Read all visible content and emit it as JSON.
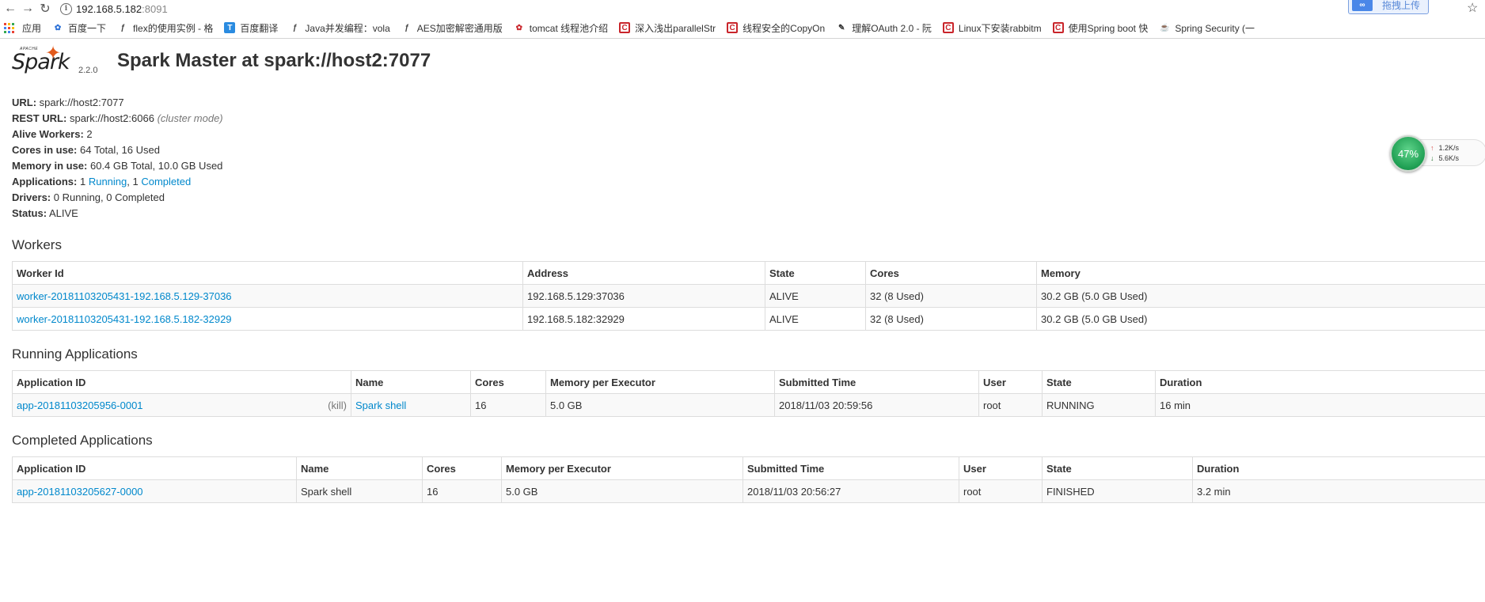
{
  "browser": {
    "url_host": "192.168.5.182",
    "url_port": ":8091",
    "upload_label": "拖拽上传",
    "bookmarks": [
      {
        "label": "应用",
        "icon": "apps-grid-icon"
      },
      {
        "label": "百度一下",
        "icon": "baidu-paw-icon"
      },
      {
        "label": "flex的使用实例 - 格",
        "icon": "leaf-icon"
      },
      {
        "label": "百度翻译",
        "icon": "translate-icon"
      },
      {
        "label": "Java并发编程：vola",
        "icon": "leaf-icon"
      },
      {
        "label": "AES加密解密通用版",
        "icon": "leaf-icon"
      },
      {
        "label": "tomcat 线程池介绍",
        "icon": "chinese-site-icon"
      },
      {
        "label": "深入浅出parallelStr",
        "icon": "csdn-icon"
      },
      {
        "label": "线程安全的CopyOn",
        "icon": "csdn-icon"
      },
      {
        "label": "理解OAuth 2.0 - 阮",
        "icon": "blog-icon"
      },
      {
        "label": "Linux下安装rabbitm",
        "icon": "csdn-icon"
      },
      {
        "label": "使用Spring boot 快",
        "icon": "csdn-icon"
      },
      {
        "label": "Spring Security (一",
        "icon": "java-icon"
      }
    ]
  },
  "header": {
    "logo_apache": "APACHE",
    "logo_word": "Spark",
    "version": "2.2.0",
    "title": "Spark Master at spark://host2:7077"
  },
  "summary": {
    "url_label": "URL:",
    "url_value": "spark://host2:7077",
    "rest_label": "REST URL:",
    "rest_value": "spark://host2:6066",
    "rest_hint": "(cluster mode)",
    "workers_label": "Alive Workers:",
    "workers_value": "2",
    "cores_label": "Cores in use:",
    "cores_value": "64 Total, 16 Used",
    "memory_label": "Memory in use:",
    "memory_value": "60.4 GB Total, 10.0 GB Used",
    "apps_label": "Applications:",
    "apps_running_count": "1",
    "apps_running_link": "Running",
    "apps_sep": ", 1",
    "apps_completed_link": "Completed",
    "drivers_label": "Drivers:",
    "drivers_value": "0 Running, 0 Completed",
    "status_label": "Status:",
    "status_value": "ALIVE"
  },
  "workers": {
    "heading": "Workers",
    "columns": [
      "Worker Id",
      "Address",
      "State",
      "Cores",
      "Memory"
    ],
    "rows": [
      {
        "id": "worker-20181103205431-192.168.5.129-37036",
        "address": "192.168.5.129:37036",
        "state": "ALIVE",
        "cores": "32 (8 Used)",
        "memory": "30.2 GB (5.0 GB Used)"
      },
      {
        "id": "worker-20181103205431-192.168.5.182-32929",
        "address": "192.168.5.182:32929",
        "state": "ALIVE",
        "cores": "32 (8 Used)",
        "memory": "30.2 GB (5.0 GB Used)"
      }
    ]
  },
  "running": {
    "heading": "Running Applications",
    "columns": [
      "Application ID",
      "Name",
      "Cores",
      "Memory per Executor",
      "Submitted Time",
      "User",
      "State",
      "Duration"
    ],
    "rows": [
      {
        "id": "app-20181103205956-0001",
        "kill": "(kill)",
        "name": "Spark shell",
        "cores": "16",
        "memory": "5.0 GB",
        "submitted": "2018/11/03 20:59:56",
        "user": "root",
        "state": "RUNNING",
        "duration": "16 min"
      }
    ]
  },
  "completed": {
    "heading": "Completed Applications",
    "columns": [
      "Application ID",
      "Name",
      "Cores",
      "Memory per Executor",
      "Submitted Time",
      "User",
      "State",
      "Duration"
    ],
    "rows": [
      {
        "id": "app-20181103205627-0000",
        "name": "Spark shell",
        "cores": "16",
        "memory": "5.0 GB",
        "submitted": "2018/11/03 20:56:27",
        "user": "root",
        "state": "FINISHED",
        "duration": "3.2 min"
      }
    ]
  },
  "netmon": {
    "percent": "47%",
    "upload": "1.2K/s",
    "download": "5.6K/s"
  },
  "colors": {
    "link": "#0088cc",
    "spark_orange": "#e25a1c",
    "gauge_green": "#1e9e52"
  }
}
